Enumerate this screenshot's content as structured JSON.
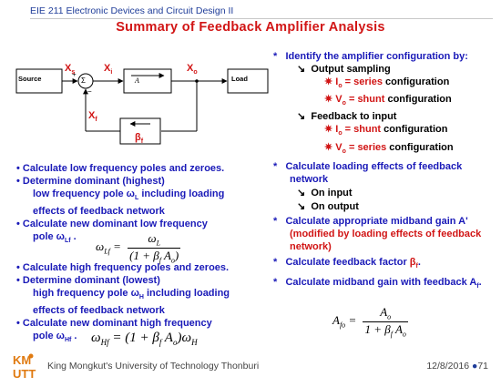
{
  "header": {
    "course": "EIE 211 Electronic Devices and Circuit Design II"
  },
  "title": "Summary of Feedback Amplifier Analysis",
  "diagram": {
    "source_label": "Source",
    "load_label": "Load",
    "amp_label": "A",
    "sum_symbol": "Σ",
    "fb_label": "βf",
    "xs": "Xs",
    "xi": "Xi",
    "xo": "Xo",
    "xf": "Xf",
    "plus": "+",
    "minus": "−"
  },
  "left": {
    "b1": "Calculate low frequency poles and zeroes.",
    "b2": "Determine dominant (highest)",
    "b2a": "low frequency pole ωL including loading",
    "b2b": "effects of feedback network",
    "b3": "Calculate new dominant low frequency",
    "b3a": "pole ωLf .",
    "b4": "Calculate high frequency poles and zeroes.",
    "b5": "Determine dominant (lowest)",
    "b5a": "high frequency pole ωH including loading",
    "b5b": "effects of feedback network",
    "b6": "Calculate new dominant high frequency",
    "b6a": "pole ωHf ."
  },
  "right": {
    "r1": "Identify the amplifier configuration by:",
    "r1a": "Output sampling",
    "r1a1a": "Io",
    "r1a1b": " = series",
    "r1a1c": " configuration",
    "r1a2a": "Vo",
    "r1a2b": " = shunt",
    "r1a2c": " configuration",
    "r1b": "Feedback to input",
    "r1b1a": "Io",
    "r1b1b": " = shunt",
    "r1b1c": " configuration",
    "r1b2a": "Vo",
    "r1b2b": " = series",
    "r1b2c": " configuration",
    "r2": "Calculate loading effects of feedback",
    "r2b": "network",
    "r2a": "On input",
    "r2c": "On output",
    "r3": "Calculate appropriate midband gain A'",
    "r3a": "(modified by loading effects of feedback",
    "r3b": "network)",
    "r4": "Calculate feedback factor βf.",
    "r5": "Calculate midband gain with feedback Af."
  },
  "footer": {
    "logo": "KMUTT",
    "university": "King Mongkut's University of Technology Thonburi",
    "date": "12/8/2016",
    "page": "71"
  }
}
